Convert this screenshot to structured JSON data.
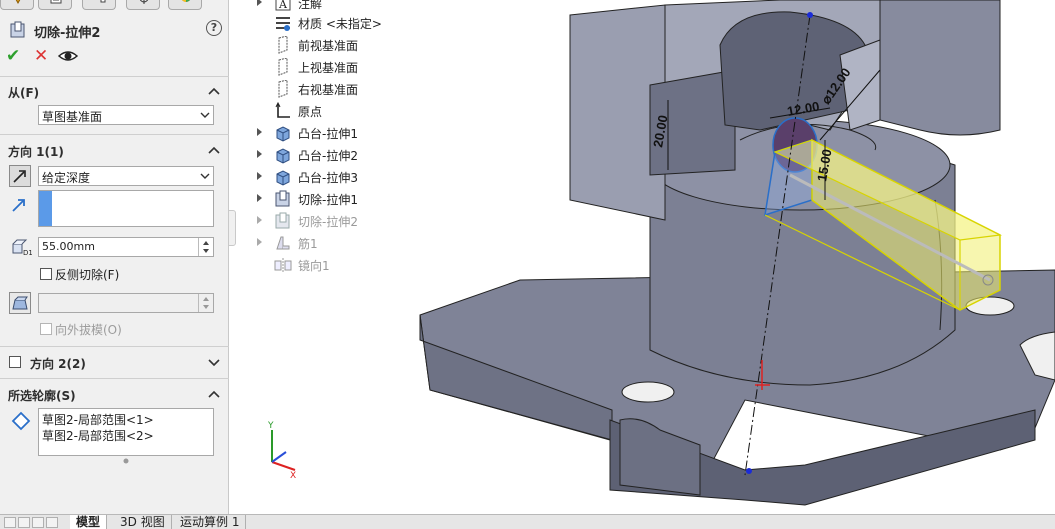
{
  "feature": {
    "title": "切除-拉伸2",
    "help": "?",
    "ok_label": "✔",
    "cancel_label": "✕"
  },
  "from": {
    "header": "从(F)",
    "value": "草图基准面"
  },
  "direction1": {
    "header": "方向 1(1)",
    "end_condition": "给定深度",
    "depth": "55.00mm",
    "flip_side": "反侧切除(F)",
    "draft_outward": "向外拔模(O)"
  },
  "direction2": {
    "header": "方向 2(2)"
  },
  "selected_contours": {
    "header": "所选轮廓(S)",
    "items": [
      "草图2-局部范围<1>",
      "草图2-局部范围<2>"
    ]
  },
  "tree": {
    "items": [
      {
        "label": "注解",
        "icon": "annotation-icon",
        "expand": true
      },
      {
        "label": "材质 <未指定>",
        "icon": "material-icon",
        "expand": false
      },
      {
        "label": "前视基准面",
        "icon": "plane-icon",
        "expand": false
      },
      {
        "label": "上视基准面",
        "icon": "plane-icon",
        "expand": false
      },
      {
        "label": "右视基准面",
        "icon": "plane-icon",
        "expand": false
      },
      {
        "label": "原点",
        "icon": "origin-icon",
        "expand": false
      },
      {
        "label": "凸台-拉伸1",
        "icon": "boss-extrude-icon",
        "expand": true
      },
      {
        "label": "凸台-拉伸2",
        "icon": "boss-extrude-icon",
        "expand": true
      },
      {
        "label": "凸台-拉伸3",
        "icon": "boss-extrude-icon",
        "expand": true
      },
      {
        "label": "切除-拉伸1",
        "icon": "cut-extrude-icon",
        "expand": true
      },
      {
        "label": "切除-拉伸2",
        "icon": "cut-extrude-icon",
        "expand": true
      },
      {
        "label": "筋1",
        "icon": "rib-icon",
        "expand": true
      },
      {
        "label": "镜向1",
        "icon": "mirror-icon",
        "expand": false
      }
    ]
  },
  "dimensions": {
    "d1": "20.00",
    "d2": "12.00",
    "d3": "⌀12.00",
    "d4": "15.00"
  },
  "bottom_tabs": [
    "模型",
    "3D 视图",
    "运动算例 1"
  ],
  "colors": {
    "panel_bg": "#f0f0f0",
    "accent_blue": "#5b9ae8",
    "part_face": "#8a8ea3",
    "preview_yellow": "#f0ef6e"
  }
}
